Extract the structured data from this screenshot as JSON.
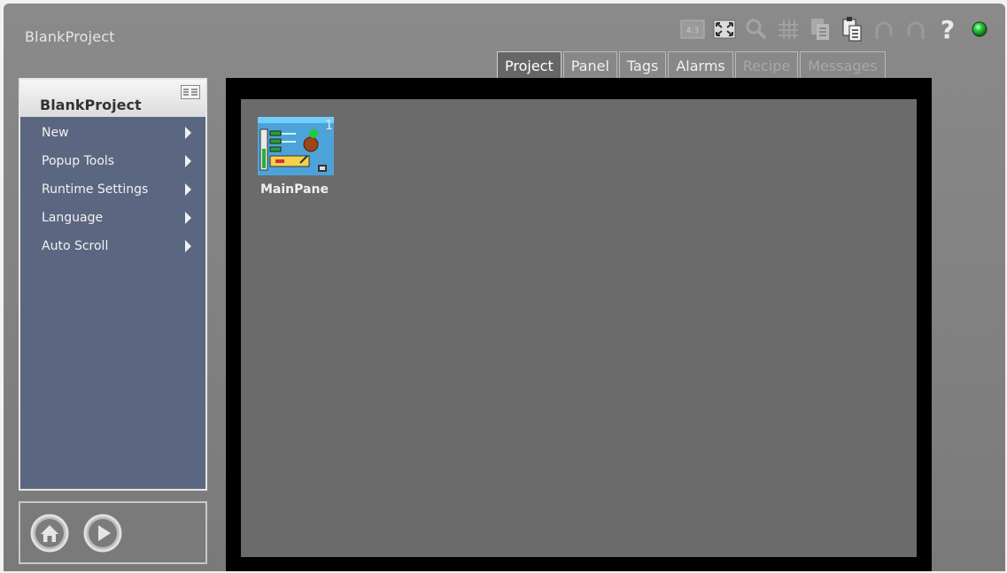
{
  "app": {
    "title": "BlankProject"
  },
  "toolbar": {
    "icons": [
      "aspect-ratio-icon",
      "fit-to-screen-icon",
      "zoom-icon",
      "grid-icon",
      "copy-icon",
      "paste-icon",
      "undo-icon",
      "redo-icon",
      "help-icon",
      "status-led-icon"
    ],
    "aspect_label": "4:3",
    "help_label": "?"
  },
  "tabs": [
    {
      "label": "Project",
      "state": "active"
    },
    {
      "label": "Panel",
      "state": "enabled"
    },
    {
      "label": "Tags",
      "state": "enabled"
    },
    {
      "label": "Alarms",
      "state": "enabled"
    },
    {
      "label": "Recipe",
      "state": "disabled"
    },
    {
      "label": "Messages",
      "state": "disabled"
    }
  ],
  "sidebar": {
    "title": "BlankProject",
    "items": [
      {
        "label": "New"
      },
      {
        "label": "Popup Tools"
      },
      {
        "label": "Runtime Settings"
      },
      {
        "label": "Language"
      },
      {
        "label": "Auto Scroll"
      }
    ]
  },
  "panels": [
    {
      "label": "MainPane",
      "number": "1"
    }
  ],
  "colors": {
    "status_led": "#22cc33",
    "sidebar_bg": "#5b6680",
    "canvas_bg": "#6b6b6b"
  }
}
